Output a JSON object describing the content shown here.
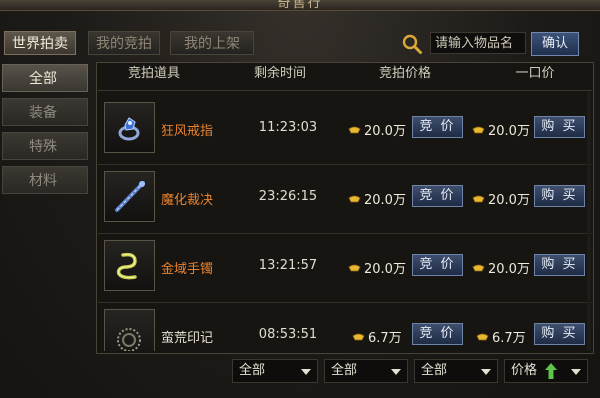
{
  "window": {
    "title": "奇售行"
  },
  "tabs": [
    {
      "label": "世界拍卖",
      "active": true
    },
    {
      "label": "我的竞拍",
      "active": false
    },
    {
      "label": "我的上架",
      "active": false
    }
  ],
  "search": {
    "placeholder": "请输入物品名",
    "confirm_label": "确认",
    "icon": "search-icon"
  },
  "categories": [
    {
      "label": "全部",
      "active": true
    },
    {
      "label": "装备",
      "active": false
    },
    {
      "label": "特殊",
      "active": false
    },
    {
      "label": "材料",
      "active": false
    }
  ],
  "table": {
    "headers": [
      "竞拍道具",
      "剩余时间",
      "竞拍价格",
      "一口价"
    ],
    "rows": [
      {
        "icon": "ring-icon",
        "name": "狂风戒指",
        "name_color": "#e8822e",
        "time": "11:23:03",
        "bid_price": "20.0万",
        "bid_label": "竞 价",
        "buyout_price": "20.0万",
        "buy_label": "购 买"
      },
      {
        "icon": "staff-icon",
        "name": "魔化裁决",
        "name_color": "#e8822e",
        "time": "23:26:15",
        "bid_price": "20.0万",
        "bid_label": "竞 价",
        "buyout_price": "20.0万",
        "buy_label": "购 买"
      },
      {
        "icon": "bracelet-icon",
        "name": "金域手镯",
        "name_color": "#e8822e",
        "time": "13:21:57",
        "bid_price": "20.0万",
        "bid_label": "竞 价",
        "buyout_price": "20.0万",
        "buy_label": "购 买"
      },
      {
        "icon": "seal-icon",
        "name": "蛮荒印记",
        "name_color": "#e8e2d2",
        "time": "08:53:51",
        "bid_price": "6.7万",
        "bid_label": "竞 价",
        "buyout_price": "6.7万",
        "buy_label": "购 买"
      }
    ]
  },
  "filters": [
    {
      "value": "全部"
    },
    {
      "value": "全部"
    },
    {
      "value": "全部"
    },
    {
      "value": "价格",
      "icon": "arrow-up-icon"
    }
  ],
  "colors": {
    "accent_orange": "#e8822e",
    "button_blue": "#2e4266",
    "sort_green": "#5fc44a",
    "gold": "#e8b830"
  }
}
